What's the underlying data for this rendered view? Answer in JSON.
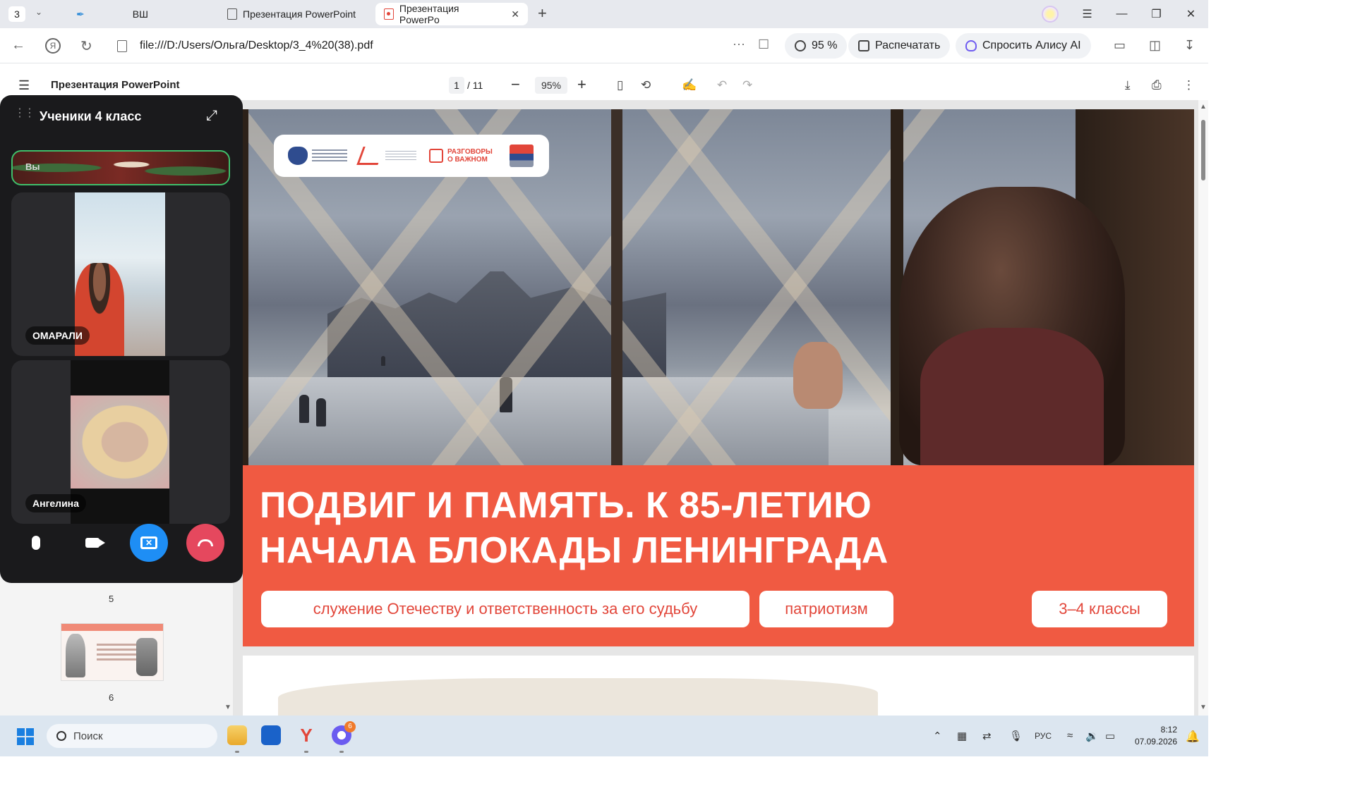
{
  "browser": {
    "tab_count": "3",
    "tabs": [
      {
        "label": "ВШ"
      },
      {
        "label": "Презентация PowerPoint"
      },
      {
        "label": "Презентация PowerPo"
      }
    ],
    "new_tab_symbol": "+",
    "url": "file:///D:/Users/Ольга/Desktop/3_4%20(38).pdf",
    "zoom_pill": "95 %",
    "print_label": "Распечатать",
    "alice_label": "Спросить Алису AI"
  },
  "pdf_toolbar": {
    "doc_title": "Презентация PowerPoint",
    "current_page": "1",
    "total_pages": "/ 11",
    "zoom": "95%"
  },
  "slide": {
    "headline_line1": "ПОДВИГ И ПАМЯТЬ. К 85-ЛЕТИЮ",
    "headline_line2": "НАЧАЛА БЛОКАДЫ ЛЕНИНГРАДА",
    "chip_service": "служение Отечеству и ответственность за его судьбу",
    "chip_patriotism": "патриотизм",
    "chip_grades": "3–4 классы",
    "logo_razgovory": "РАЗГОВОРЫ О ВАЖНОМ",
    "accent_color": "#f05a42"
  },
  "thumbnails": {
    "page5": "5",
    "page6": "6"
  },
  "call": {
    "title": "Ученики 4 класс",
    "self_label": "Вы",
    "participants": [
      {
        "name": "ОМАРАЛИ"
      },
      {
        "name": "Ангелина"
      }
    ],
    "screen_share_color": "#1e8ef5",
    "hangup_color": "#e5485e"
  },
  "taskbar": {
    "search_placeholder": "Поиск",
    "messenger_badge": "6",
    "language": "РУС",
    "time": "8:12",
    "date": "07.09.2026"
  }
}
